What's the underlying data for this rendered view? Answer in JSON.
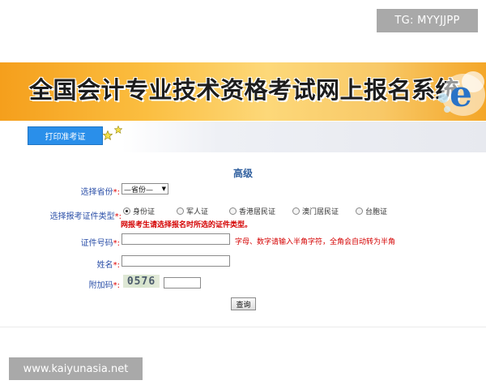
{
  "watermarks": {
    "top": "TG: MYYJJPP",
    "bottom": "www.kaiyunasia.net"
  },
  "banner": {
    "title": "全国会计专业技术资格考试网上报名系统",
    "logo_letter": "e"
  },
  "toolbar": {
    "print_label": "打印准考证"
  },
  "form": {
    "heading": "高级",
    "province": {
      "label": "选择省份",
      "required_mark": "*:",
      "selected": "—省份—"
    },
    "id_type": {
      "label": "选择报考证件类型",
      "required_mark": "*:",
      "options": [
        {
          "label": "身份证",
          "checked": true
        },
        {
          "label": "军人证",
          "checked": false
        },
        {
          "label": "香港居民证",
          "checked": false
        },
        {
          "label": "澳门居民证",
          "checked": false
        },
        {
          "label": "台胞证",
          "checked": false
        }
      ],
      "note": "网报考生请选择报名时所选的证件类型。"
    },
    "id_number": {
      "label": "证件号码",
      "required_mark": "*:",
      "value": "",
      "hint": "字母、数字请输入半角字符，全角会自动转为半角"
    },
    "name": {
      "label": "姓名",
      "required_mark": "*:",
      "value": ""
    },
    "captcha": {
      "label": "附加码",
      "required_mark": "*:",
      "code": "0576",
      "value": ""
    },
    "submit_label": "查询"
  },
  "colors": {
    "banner_orange": "#f59f1c",
    "button_blue": "#2a8fea",
    "label_blue": "#2b4fa8",
    "required_red": "#e00000"
  }
}
